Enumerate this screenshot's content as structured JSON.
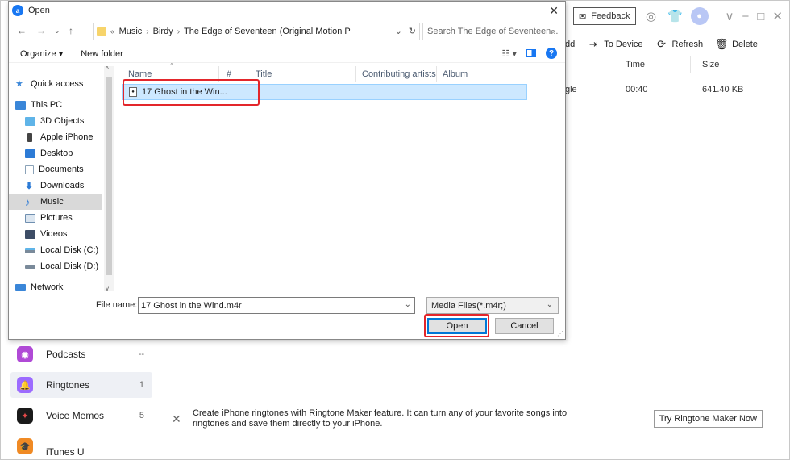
{
  "app": {
    "feedback_label": "Feedback",
    "toolbar": {
      "add_label": "dd",
      "to_device_label": "To Device",
      "refresh_label": "Refresh",
      "delete_label": "Delete"
    },
    "columns": {
      "time": "Time",
      "size": "Size"
    },
    "row": {
      "name": "gle",
      "time": "00:40",
      "size": "641.40 KB"
    },
    "sidebar": [
      {
        "label": "Podcasts",
        "count": "--",
        "color": "#b04ad6",
        "icon": "podcast-icon"
      },
      {
        "label": "Ringtones",
        "count": "1",
        "color": "#9c6bff",
        "icon": "bell-icon"
      },
      {
        "label": "Voice Memos",
        "count": "5",
        "color": "#1a1a1a",
        "icon": "waveform-icon"
      },
      {
        "label": "iTunes U",
        "count": "",
        "color": "#f08a24",
        "icon": "graduation-cap-icon"
      }
    ],
    "banner": {
      "line1": "Create iPhone ringtones with Ringtone Maker feature. It can turn any of your favorite songs into",
      "line2": "ringtones and save them directly to your iPhone.",
      "button_label": "Try Ringtone Maker Now"
    }
  },
  "dialog": {
    "title": "Open",
    "breadcrumb": {
      "prefix": "«",
      "items": [
        "Music",
        "Birdy",
        "The Edge of Seventeen (Original Motion P"
      ]
    },
    "search_placeholder": "Search The Edge of Seventeen...",
    "commands": {
      "organize": "Organize ▾",
      "new_folder": "New folder"
    },
    "tree": [
      {
        "label": "Quick access",
        "icon": "star-icon",
        "color": "#3a86d8",
        "top": true
      },
      {
        "label": "This PC",
        "icon": "computer-icon",
        "color": "#3a86d8",
        "top": true
      },
      {
        "label": "3D Objects",
        "icon": "cube-icon",
        "color": "#5fb4e8"
      },
      {
        "label": "Apple iPhone",
        "icon": "phone-icon",
        "color": "#444444"
      },
      {
        "label": "Desktop",
        "icon": "desktop-icon",
        "color": "#2d7bd6"
      },
      {
        "label": "Documents",
        "icon": "document-icon",
        "color": "#8aa2b8"
      },
      {
        "label": "Downloads",
        "icon": "download-icon",
        "color": "#2d7bd6"
      },
      {
        "label": "Music",
        "icon": "music-note-icon",
        "color": "#2d7bd6",
        "selected": true
      },
      {
        "label": "Pictures",
        "icon": "picture-icon",
        "color": "#6f8fb0"
      },
      {
        "label": "Videos",
        "icon": "video-icon",
        "color": "#3d4d66"
      },
      {
        "label": "Local Disk (C:)",
        "icon": "disk-icon",
        "color": "#7a8a9a"
      },
      {
        "label": "Local Disk (D:)",
        "icon": "disk-icon",
        "color": "#7a8a9a"
      },
      {
        "label": "Network",
        "icon": "network-icon",
        "color": "#3a86d8",
        "top": true
      }
    ],
    "columns": {
      "name": "Name",
      "number": "#",
      "title": "Title",
      "artists": "Contributing artists",
      "album": "Album"
    },
    "file": {
      "name": "17 Ghost in the Win..."
    },
    "file_name_label": "File name:",
    "file_name_value": "17 Ghost in the Wind.m4r",
    "filter_value": "Media Files(*.m4r;)",
    "open_label": "Open",
    "cancel_label": "Cancel"
  }
}
